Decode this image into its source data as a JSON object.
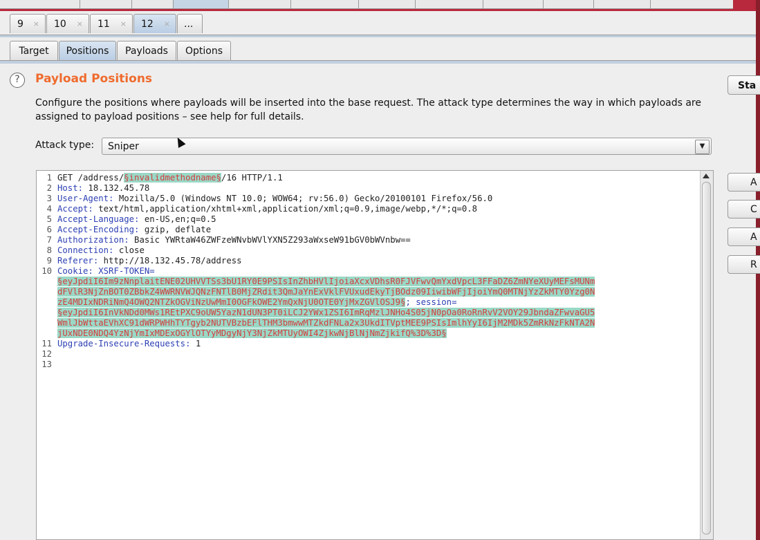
{
  "request_tabs": {
    "tabs": [
      {
        "label": "9"
      },
      {
        "label": "10"
      },
      {
        "label": "11"
      },
      {
        "label": "12",
        "active": true
      }
    ],
    "more_label": "...",
    "close_glyph": "×"
  },
  "sub_tabs": [
    {
      "label": "Target"
    },
    {
      "label": "Positions",
      "active": true
    },
    {
      "label": "Payloads"
    },
    {
      "label": "Options"
    }
  ],
  "section": {
    "help_icon": "help-circle-icon",
    "help_glyph": "?",
    "title": "Payload Positions",
    "description": "Configure the positions where payloads will be inserted into the base request. The attack type determines the way in which payloads are assigned to payload positions – see help for full details."
  },
  "attack": {
    "label": "Attack type:",
    "selected": "Sniper",
    "arrow_glyph": "▼"
  },
  "start_button_label": "Sta",
  "side_buttons": [
    "A",
    "C",
    "A",
    "R"
  ],
  "editor": {
    "lines": [
      {
        "n": "1",
        "parts": [
          {
            "t": "GET /address/",
            "c": "val"
          },
          {
            "t": "§invalidmethodname§",
            "c": "pl"
          },
          {
            "t": "/16 HTTP/1.1",
            "c": "val"
          }
        ]
      },
      {
        "n": "2",
        "parts": [
          {
            "t": "Host:",
            "c": "hdr"
          },
          {
            "t": " 18.132.45.78",
            "c": "val"
          }
        ]
      },
      {
        "n": "3",
        "parts": [
          {
            "t": "User-Agent:",
            "c": "hdr"
          },
          {
            "t": " Mozilla/5.0 (Windows NT 10.0; WOW64; rv:56.0) Gecko/20100101 Firefox/56.0",
            "c": "val"
          }
        ]
      },
      {
        "n": "4",
        "parts": [
          {
            "t": "Accept:",
            "c": "hdr"
          },
          {
            "t": " text/html,application/xhtml+xml,application/xml;q=0.9,image/webp,*/*;q=0.8",
            "c": "val"
          }
        ]
      },
      {
        "n": "5",
        "parts": [
          {
            "t": "Accept-Language:",
            "c": "hdr"
          },
          {
            "t": " en-US,en;q=0.5",
            "c": "val"
          }
        ]
      },
      {
        "n": "6",
        "parts": [
          {
            "t": "Accept-Encoding:",
            "c": "hdr"
          },
          {
            "t": " gzip, deflate",
            "c": "val"
          }
        ]
      },
      {
        "n": "7",
        "parts": [
          {
            "t": "Authorization:",
            "c": "hdr"
          },
          {
            "t": " Basic YWRtaW46ZWFzeWNvbWVlYXN5Z293aWxseW91bGV0bWVnbw==",
            "c": "val"
          }
        ]
      },
      {
        "n": "8",
        "parts": [
          {
            "t": "Connection:",
            "c": "hdr"
          },
          {
            "t": " close",
            "c": "val"
          }
        ]
      },
      {
        "n": "9",
        "parts": [
          {
            "t": "Referer:",
            "c": "hdr"
          },
          {
            "t": " http://18.132.45.78/address",
            "c": "val"
          }
        ]
      },
      {
        "n": "10",
        "parts": [
          {
            "t": "Cookie:",
            "c": "hdr"
          },
          {
            "t": " XSRF-TOKEN=",
            "c": "hdr"
          }
        ]
      },
      {
        "n": "",
        "parts": [
          {
            "t": "§eyJpdiI6Im9zNnplaitENE02UHVVTSs3bU1RY0E9PSIsInZhbHVlIjoiaXcxVDhsR0FJVFwvQmYxdVpcL3FFaDZ6ZmNYeXUyMEFsMUNm",
            "c": "pl"
          }
        ]
      },
      {
        "n": "",
        "parts": [
          {
            "t": "dFVlR3NjZnBOT0ZBbkZ4WWRNVWJQNzFNTlB0MjZRdit3QmJaYnExVklFVUxudEkyTjBOdz09IiwibWFjIjoiYmQ0MTNjYzZkMTY0Yzg0N",
            "c": "pl"
          }
        ]
      },
      {
        "n": "",
        "parts": [
          {
            "t": "zE4MDIxNDRiNmQ4OWQ2NTZkOGViNzUwMmI0OGFkOWE2YmQxNjU0OTE0YjMxZGVlOSJ9§",
            "c": "pl"
          },
          {
            "t": "; session=",
            "c": "hdr"
          }
        ]
      },
      {
        "n": "",
        "parts": [
          {
            "t": "§eyJpdiI6InVkNDd0MWs1REtPXC9oUW5YazN1dUN3PT0iLCJ2YWx1ZSI6ImRqMzlJNHo4S05jN0pOa0RoRnRvV2VOY29JbndaZFwvaGU5",
            "c": "pl"
          }
        ]
      },
      {
        "n": "",
        "parts": [
          {
            "t": "WmlJbWttaEVhXC91dWRPWHhTYTgyb2NUTVBzbEFlTHM3bmwwMTZkdFNLa2x3UkdITVptMEE9PSIsImlhYyI6IjM2MDk5ZmRkNzFkNTA2N",
            "c": "pl"
          }
        ]
      },
      {
        "n": "",
        "parts": [
          {
            "t": "jUxNDE0NDQ4YzNjYmIxMDExOGYlOTYyMDgyNjY3NjZkMTUyOWI4ZjkwNjBlNjNmZjkifQ%3D%3D§",
            "c": "pl"
          }
        ]
      },
      {
        "n": "11",
        "parts": [
          {
            "t": "Upgrade-Insecure-Requests:",
            "c": "hdr"
          },
          {
            "t": " 1",
            "c": "val"
          }
        ]
      },
      {
        "n": "12",
        "parts": []
      },
      {
        "n": "13",
        "parts": []
      }
    ]
  }
}
